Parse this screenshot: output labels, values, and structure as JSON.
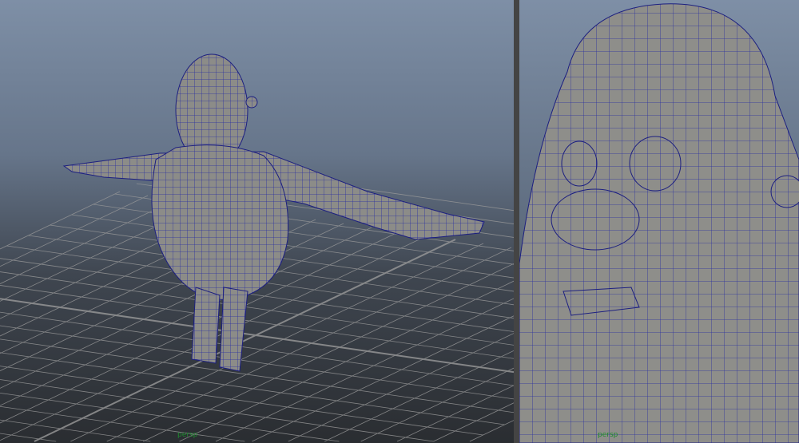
{
  "viewports": [
    {
      "name": "left-perspective-viewport",
      "camera_label": "persp"
    },
    {
      "name": "right-closeup-viewport",
      "camera_label": "persp"
    }
  ],
  "colors": {
    "wireframe": "#2a2fa0",
    "mesh": "#8e8e8a",
    "grid": "#9a9a9a",
    "label": "#1e8a2e"
  }
}
